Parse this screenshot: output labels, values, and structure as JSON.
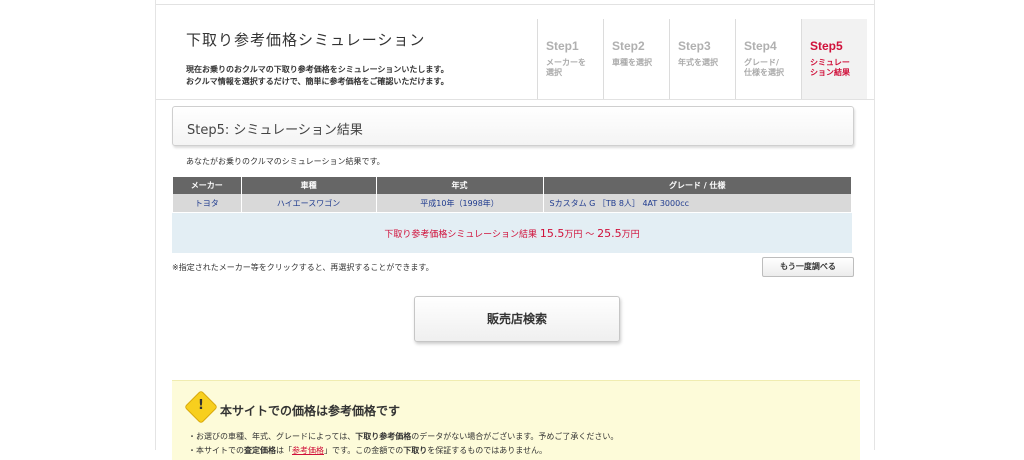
{
  "header": {
    "title": "下取り参考価格シミュレーション",
    "desc_line1": "現在お乗りのおクルマの下取り参考価格をシミュレーションいたします。",
    "desc_line2": "おクルマ情報を選択するだけで、簡単に参考価格をご確認いただけます。"
  },
  "steps": [
    {
      "num": "Step1",
      "label": "メーカーを選択"
    },
    {
      "num": "Step2",
      "label": "車種を選択"
    },
    {
      "num": "Step3",
      "label": "年式を選択"
    },
    {
      "num": "Step4",
      "label": "グレード/仕様を選択"
    },
    {
      "num": "Step5",
      "label": "シミュレーション結果",
      "active": true
    }
  ],
  "section_title": "Step5:  シミュレーション結果",
  "intro": "あなたがお乗りのクルマのシミュレーション結果です。",
  "table": {
    "headers": [
      "メーカー",
      "車種",
      "年式",
      "グレード / 仕様"
    ],
    "row": [
      "トヨタ",
      "ハイエースワゴン",
      "平成10年（1998年）",
      "Sカスタム G ［TB 8人］ 4AT 3000cc"
    ]
  },
  "result": {
    "prefix": "下取り参考価格シミュレーション結果 ",
    "low": "15.5",
    "unit": "万円",
    "sep": " ～ ",
    "high": "25.5"
  },
  "note": "※指定されたメーカー等をクリックすると、再選択することができます。",
  "again_button": "もう一度調べる",
  "search_button": "販売店検索",
  "notice": {
    "icon_mark": "!",
    "title": "本サイトでの価格は参考価格です",
    "line1_a": "・お選びの車種、年式、グレードによっては、",
    "line1_b": "下取り参考価格",
    "line1_c": "のデータがない場合がございます。予めご了承ください。",
    "line2_a": "・本サイトでの",
    "line2_b": "査定価格",
    "line2_c": "は「",
    "line2_d": "参考価格",
    "line2_e": "」です。この金額での",
    "line2_f": "下取り",
    "line2_g": "を保証するものではありません。"
  }
}
